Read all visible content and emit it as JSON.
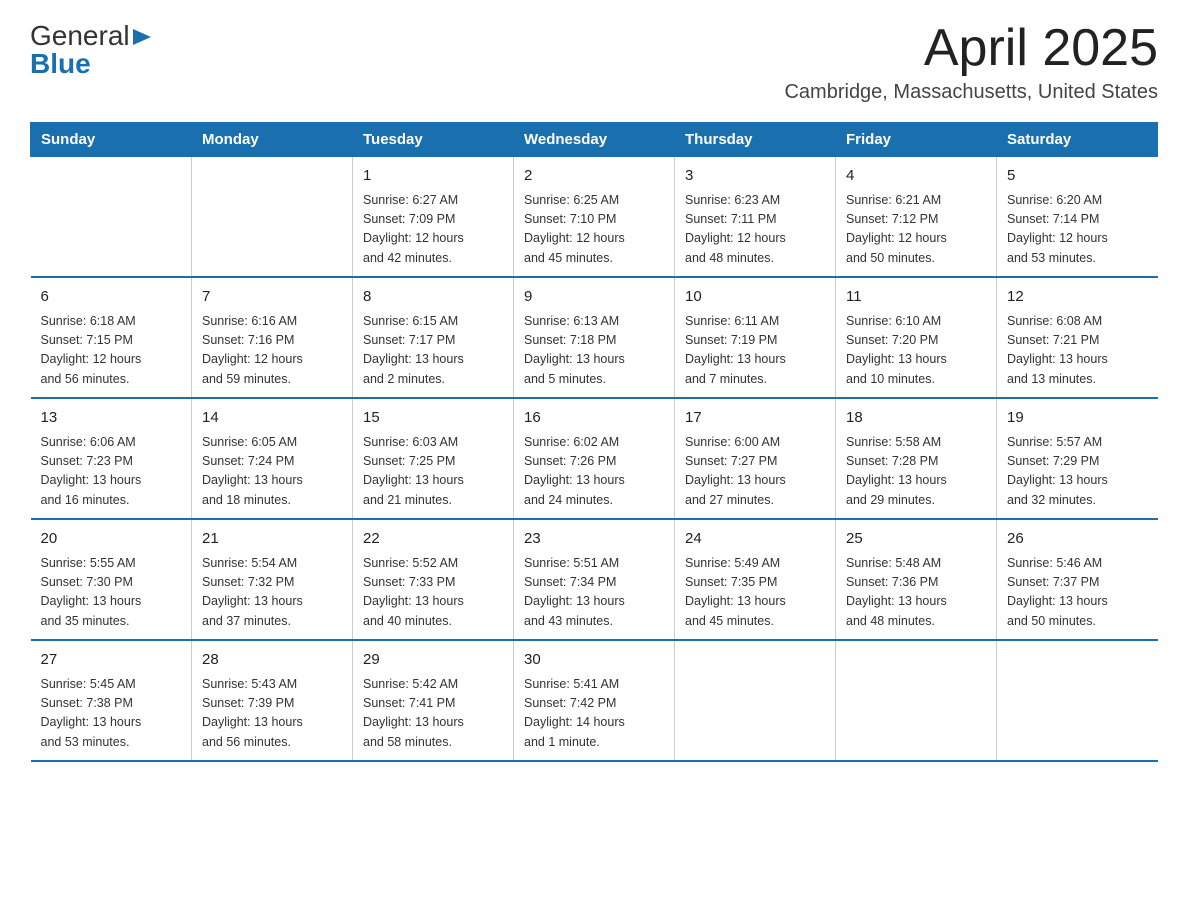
{
  "header": {
    "logo_general": "General",
    "logo_blue": "Blue",
    "calendar_title": "April 2025",
    "calendar_subtitle": "Cambridge, Massachusetts, United States"
  },
  "weekdays": [
    "Sunday",
    "Monday",
    "Tuesday",
    "Wednesday",
    "Thursday",
    "Friday",
    "Saturday"
  ],
  "weeks": [
    [
      {
        "day": "",
        "info": ""
      },
      {
        "day": "",
        "info": ""
      },
      {
        "day": "1",
        "info": "Sunrise: 6:27 AM\nSunset: 7:09 PM\nDaylight: 12 hours\nand 42 minutes."
      },
      {
        "day": "2",
        "info": "Sunrise: 6:25 AM\nSunset: 7:10 PM\nDaylight: 12 hours\nand 45 minutes."
      },
      {
        "day": "3",
        "info": "Sunrise: 6:23 AM\nSunset: 7:11 PM\nDaylight: 12 hours\nand 48 minutes."
      },
      {
        "day": "4",
        "info": "Sunrise: 6:21 AM\nSunset: 7:12 PM\nDaylight: 12 hours\nand 50 minutes."
      },
      {
        "day": "5",
        "info": "Sunrise: 6:20 AM\nSunset: 7:14 PM\nDaylight: 12 hours\nand 53 minutes."
      }
    ],
    [
      {
        "day": "6",
        "info": "Sunrise: 6:18 AM\nSunset: 7:15 PM\nDaylight: 12 hours\nand 56 minutes."
      },
      {
        "day": "7",
        "info": "Sunrise: 6:16 AM\nSunset: 7:16 PM\nDaylight: 12 hours\nand 59 minutes."
      },
      {
        "day": "8",
        "info": "Sunrise: 6:15 AM\nSunset: 7:17 PM\nDaylight: 13 hours\nand 2 minutes."
      },
      {
        "day": "9",
        "info": "Sunrise: 6:13 AM\nSunset: 7:18 PM\nDaylight: 13 hours\nand 5 minutes."
      },
      {
        "day": "10",
        "info": "Sunrise: 6:11 AM\nSunset: 7:19 PM\nDaylight: 13 hours\nand 7 minutes."
      },
      {
        "day": "11",
        "info": "Sunrise: 6:10 AM\nSunset: 7:20 PM\nDaylight: 13 hours\nand 10 minutes."
      },
      {
        "day": "12",
        "info": "Sunrise: 6:08 AM\nSunset: 7:21 PM\nDaylight: 13 hours\nand 13 minutes."
      }
    ],
    [
      {
        "day": "13",
        "info": "Sunrise: 6:06 AM\nSunset: 7:23 PM\nDaylight: 13 hours\nand 16 minutes."
      },
      {
        "day": "14",
        "info": "Sunrise: 6:05 AM\nSunset: 7:24 PM\nDaylight: 13 hours\nand 18 minutes."
      },
      {
        "day": "15",
        "info": "Sunrise: 6:03 AM\nSunset: 7:25 PM\nDaylight: 13 hours\nand 21 minutes."
      },
      {
        "day": "16",
        "info": "Sunrise: 6:02 AM\nSunset: 7:26 PM\nDaylight: 13 hours\nand 24 minutes."
      },
      {
        "day": "17",
        "info": "Sunrise: 6:00 AM\nSunset: 7:27 PM\nDaylight: 13 hours\nand 27 minutes."
      },
      {
        "day": "18",
        "info": "Sunrise: 5:58 AM\nSunset: 7:28 PM\nDaylight: 13 hours\nand 29 minutes."
      },
      {
        "day": "19",
        "info": "Sunrise: 5:57 AM\nSunset: 7:29 PM\nDaylight: 13 hours\nand 32 minutes."
      }
    ],
    [
      {
        "day": "20",
        "info": "Sunrise: 5:55 AM\nSunset: 7:30 PM\nDaylight: 13 hours\nand 35 minutes."
      },
      {
        "day": "21",
        "info": "Sunrise: 5:54 AM\nSunset: 7:32 PM\nDaylight: 13 hours\nand 37 minutes."
      },
      {
        "day": "22",
        "info": "Sunrise: 5:52 AM\nSunset: 7:33 PM\nDaylight: 13 hours\nand 40 minutes."
      },
      {
        "day": "23",
        "info": "Sunrise: 5:51 AM\nSunset: 7:34 PM\nDaylight: 13 hours\nand 43 minutes."
      },
      {
        "day": "24",
        "info": "Sunrise: 5:49 AM\nSunset: 7:35 PM\nDaylight: 13 hours\nand 45 minutes."
      },
      {
        "day": "25",
        "info": "Sunrise: 5:48 AM\nSunset: 7:36 PM\nDaylight: 13 hours\nand 48 minutes."
      },
      {
        "day": "26",
        "info": "Sunrise: 5:46 AM\nSunset: 7:37 PM\nDaylight: 13 hours\nand 50 minutes."
      }
    ],
    [
      {
        "day": "27",
        "info": "Sunrise: 5:45 AM\nSunset: 7:38 PM\nDaylight: 13 hours\nand 53 minutes."
      },
      {
        "day": "28",
        "info": "Sunrise: 5:43 AM\nSunset: 7:39 PM\nDaylight: 13 hours\nand 56 minutes."
      },
      {
        "day": "29",
        "info": "Sunrise: 5:42 AM\nSunset: 7:41 PM\nDaylight: 13 hours\nand 58 minutes."
      },
      {
        "day": "30",
        "info": "Sunrise: 5:41 AM\nSunset: 7:42 PM\nDaylight: 14 hours\nand 1 minute."
      },
      {
        "day": "",
        "info": ""
      },
      {
        "day": "",
        "info": ""
      },
      {
        "day": "",
        "info": ""
      }
    ]
  ],
  "colors": {
    "header_bg": "#1a6faf",
    "header_text": "#ffffff",
    "border": "#1a6faf",
    "accent_blue": "#1a6faf"
  }
}
